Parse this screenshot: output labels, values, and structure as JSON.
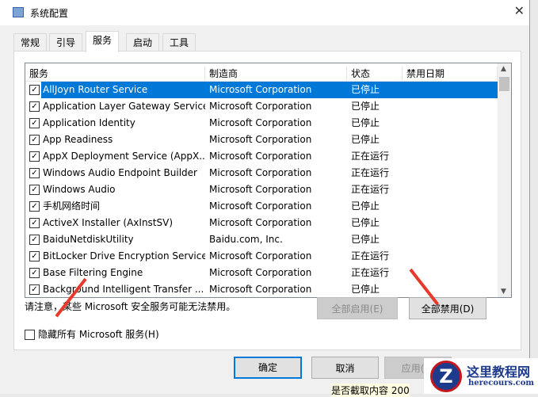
{
  "window": {
    "title": "系统配置",
    "close": "✕"
  },
  "tabs": [
    {
      "label": "常规"
    },
    {
      "label": "引导"
    },
    {
      "label": "服务",
      "active": true
    },
    {
      "label": "启动"
    },
    {
      "label": "工具"
    }
  ],
  "columns": [
    "服务",
    "制造商",
    "状态",
    "禁用日期"
  ],
  "rows": [
    {
      "name": "AllJoyn Router Service",
      "maker": "Microsoft Corporation",
      "status": "已停止",
      "checked": true,
      "selected": true
    },
    {
      "name": "Application Layer Gateway Service",
      "maker": "Microsoft Corporation",
      "status": "已停止",
      "checked": true
    },
    {
      "name": "Application Identity",
      "maker": "Microsoft Corporation",
      "status": "已停止",
      "checked": true
    },
    {
      "name": "App Readiness",
      "maker": "Microsoft Corporation",
      "status": "已停止",
      "checked": true
    },
    {
      "name": "AppX Deployment Service (AppX...",
      "maker": "Microsoft Corporation",
      "status": "正在运行",
      "checked": true
    },
    {
      "name": "Windows Audio Endpoint Builder",
      "maker": "Microsoft Corporation",
      "status": "正在运行",
      "checked": true
    },
    {
      "name": "Windows Audio",
      "maker": "Microsoft Corporation",
      "status": "正在运行",
      "checked": true
    },
    {
      "name": "手机网络时间",
      "maker": "Microsoft Corporation",
      "status": "已停止",
      "checked": true
    },
    {
      "name": "ActiveX Installer (AxInstSV)",
      "maker": "Microsoft Corporation",
      "status": "已停止",
      "checked": true
    },
    {
      "name": "BaiduNetdiskUtility",
      "maker": "Baidu.com, Inc.",
      "status": "已停止",
      "checked": true
    },
    {
      "name": "BitLocker Drive Encryption Service",
      "maker": "Microsoft Corporation",
      "status": "正在运行",
      "checked": true
    },
    {
      "name": "Base Filtering Engine",
      "maker": "Microsoft Corporation",
      "status": "正在运行",
      "checked": true
    },
    {
      "name": "Background Intelligent Transfer ...",
      "maker": "Microsoft Corporation",
      "status": "已停止",
      "checked": true
    }
  ],
  "note": "请注意，某些 Microsoft 安全服务可能无法禁用。",
  "buttons": {
    "enable_all": "全部启用(E)",
    "disable_all": "全部禁用(D)",
    "ok": "确定",
    "cancel": "取消",
    "apply": "应用(A)"
  },
  "hide_ms": {
    "label": "隐藏所有 Microsoft 服务(H)",
    "checked": false
  },
  "watermark": {
    "name": "这里教程网",
    "url": "herecours.com"
  },
  "background_text": "是否截取内容 200"
}
